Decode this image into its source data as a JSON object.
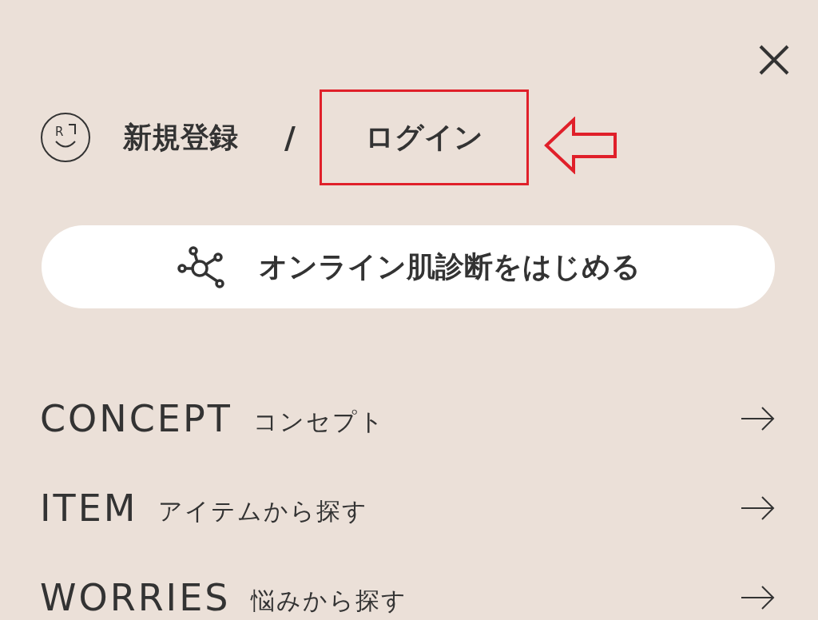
{
  "logo": {
    "letter": "R"
  },
  "account": {
    "register": "新規登録",
    "separator": "/",
    "login": "ログイン",
    "login_highlighted": true
  },
  "diagnosis_button": {
    "label": "オンライン肌診断をはじめる"
  },
  "menu": [
    {
      "title": "CONCEPT",
      "subtitle": "コンセプト"
    },
    {
      "title": "ITEM",
      "subtitle": "アイテムから探す"
    },
    {
      "title": "WORRIES",
      "subtitle": "悩みから探す"
    }
  ]
}
